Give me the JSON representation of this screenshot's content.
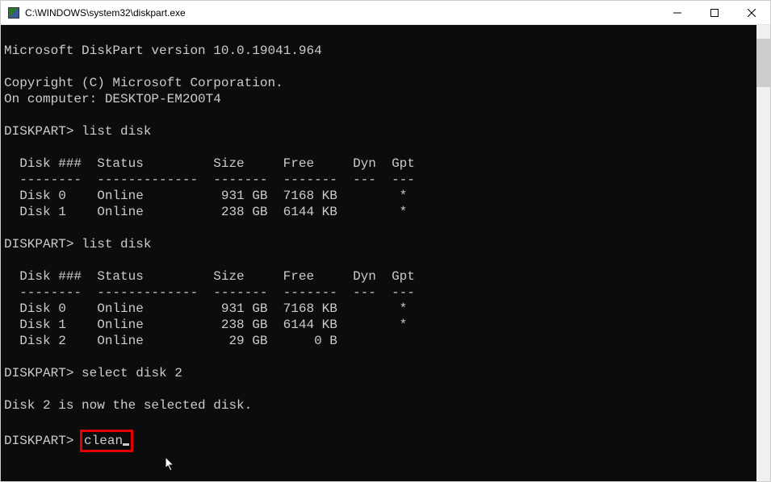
{
  "window": {
    "title": "C:\\WINDOWS\\system32\\diskpart.exe"
  },
  "terminal": {
    "version_line": "Microsoft DiskPart version 10.0.19041.964",
    "copyright": "Copyright (C) Microsoft Corporation.",
    "computer": "On computer: DESKTOP-EM2O0T4",
    "prompt": "DISKPART>",
    "cmd_list_disk": "list disk",
    "header": "  Disk ###  Status         Size     Free     Dyn  Gpt",
    "divider": "  --------  -------------  -------  -------  ---  ---",
    "list1_row0": "  Disk 0    Online          931 GB  7168 KB        *",
    "list1_row1": "  Disk 1    Online          238 GB  6144 KB        *",
    "list2_row0": "  Disk 0    Online          931 GB  7168 KB        *",
    "list2_row1": "  Disk 1    Online          238 GB  6144 KB        *",
    "list2_row2": "  Disk 2    Online           29 GB      0 B",
    "cmd_select": "select disk 2",
    "select_result": "Disk 2 is now the selected disk.",
    "cmd_clean": "clean"
  }
}
